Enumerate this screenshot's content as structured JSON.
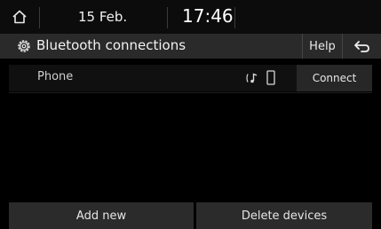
{
  "status_bar": {
    "date": "15 Feb.",
    "time": "17:46"
  },
  "header": {
    "title": "Bluetooth connections",
    "help_label": "Help"
  },
  "devices": [
    {
      "name": "Phone",
      "action_label": "Connect"
    }
  ],
  "footer": {
    "add_label": "Add new",
    "delete_label": "Delete devices"
  },
  "icons": {
    "home": "home-icon",
    "settings": "settings-gear-icon",
    "back": "back-arrow-icon",
    "audio": "bluetooth-audio-icon",
    "phone": "phone-icon"
  }
}
